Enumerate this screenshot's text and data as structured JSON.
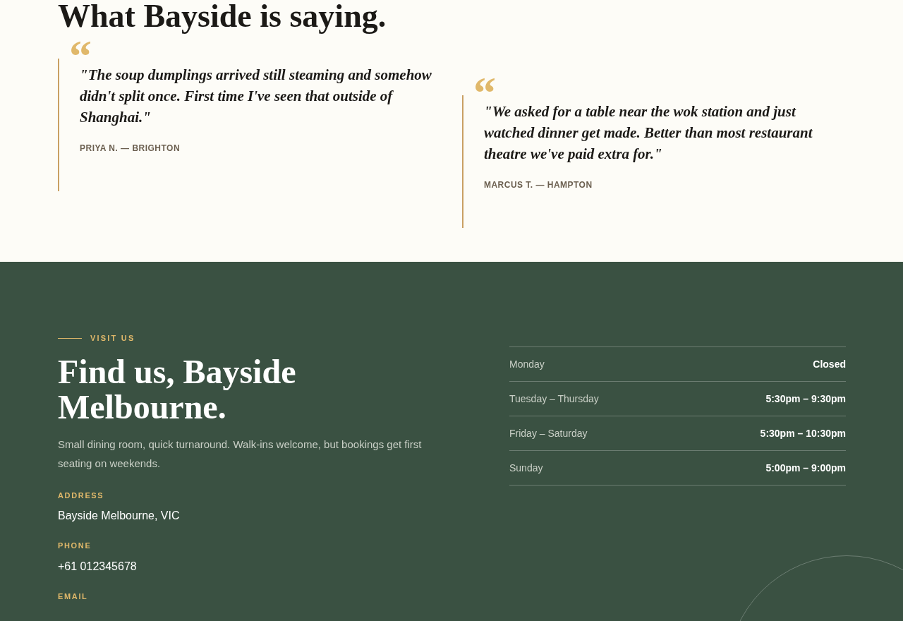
{
  "testimonials": {
    "heading": "What Bayside is saying.",
    "items": [
      {
        "mark": "“",
        "quote": "\"The soup dumplings arrived still steaming and somehow didn't split once. First time I've seen that outside of Shanghai.\"",
        "author": "PRIYA N. — BRIGHTON"
      },
      {
        "mark": "“",
        "quote": "\"We asked for a table near the wok station and just watched dinner get made. Better than most restaurant theatre we've paid extra for.\"",
        "author": "MARCUS T. — HAMPTON"
      }
    ]
  },
  "visit": {
    "eyebrow": "VISIT US",
    "heading": "Find us, Bayside Melbourne.",
    "description": "Small dining room, quick turnaround. Walk-ins welcome, but bookings get first seating on weekends.",
    "details": [
      {
        "label": "ADDRESS",
        "value": "Bayside Melbourne, VIC"
      },
      {
        "label": "PHONE",
        "value": "+61 012345678"
      },
      {
        "label": "EMAIL"
      }
    ],
    "hours": [
      {
        "day": "Monday",
        "time": "Closed"
      },
      {
        "day": "Tuesday – Thursday",
        "time": "5:30pm – 9:30pm"
      },
      {
        "day": "Friday – Saturday",
        "time": "5:30pm – 10:30pm"
      },
      {
        "day": "Sunday",
        "time": "5:00pm – 9:00pm"
      }
    ]
  }
}
